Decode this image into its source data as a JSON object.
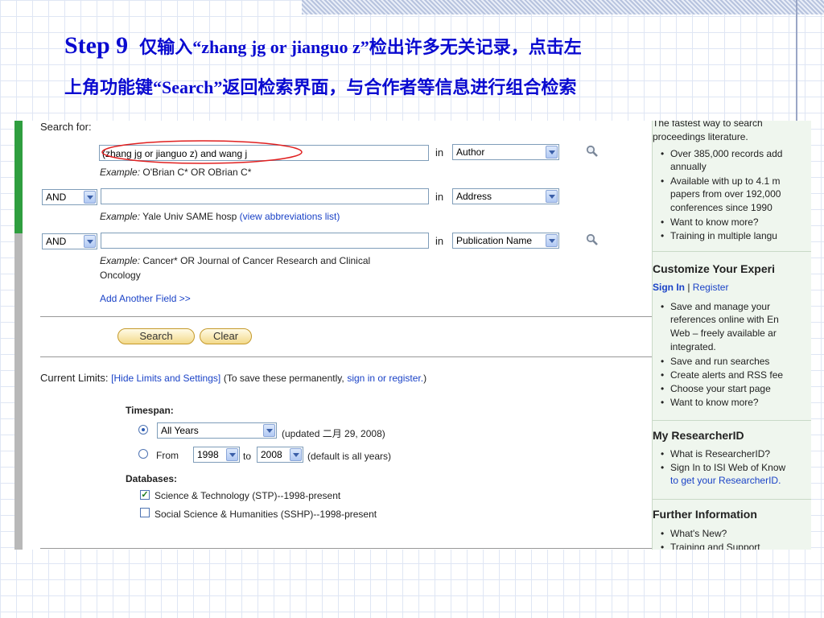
{
  "slide": {
    "step": "Step 9",
    "title_line1": "仅输入“zhang jg or jianguo z”检出许多无关记录，点击左",
    "title_line2": "上角功能键“Search”返回检索界面，与合作者等信息进行组合检索"
  },
  "search": {
    "heading": "Search for:",
    "in_label": "in",
    "rows": [
      {
        "operator": "",
        "value": "(zhang jg or jianguo z) and wang j",
        "field": "Author",
        "example_prefix": "Example:",
        "example": "O'Brian C* OR OBrian C*"
      },
      {
        "operator": "AND",
        "value": "",
        "field": "Address",
        "example_prefix": "Example:",
        "example": "Yale Univ SAME hosp",
        "example_link": "(view abbreviations list)"
      },
      {
        "operator": "AND",
        "value": "",
        "field": "Publication Name",
        "example_prefix": "Example:",
        "example": "Cancer* OR Journal of Cancer Research and Clinical",
        "example_line2": "Oncology"
      }
    ],
    "add_field": "Add Another Field >>",
    "search_button": "Search",
    "clear_button": "Clear"
  },
  "limits": {
    "label": "Current Limits:",
    "hide_link": "[Hide Limits and Settings]",
    "save_prefix": "(To save these permanently,",
    "save_link": "sign in or register.",
    "save_suffix": ")",
    "timespan_label": "Timespan:",
    "all_years": "All Years",
    "updated": "(updated 二月 29, 2008)",
    "from_label": "From",
    "from_year": "1998",
    "to_label": "to",
    "to_year": "2008",
    "default_note": "(default is all years)",
    "databases_label": "Databases:",
    "db1": "Science & Technology (STP)--1998-present",
    "db2": "Social Science & Humanities (SSHP)--1998-present"
  },
  "sidebar": {
    "intro1": "The fastest way to search",
    "intro2": "proceedings literature.",
    "bullets1": [
      "Over 385,000 records add",
      "annually",
      "Available with up to 4.1 m",
      "papers from over 192,000",
      "conferences since 1990",
      "Want to know more?",
      "Training in multiple langu"
    ],
    "customize_title": "Customize Your Experi",
    "sign_in": "Sign In",
    "pipe": " | ",
    "register": "Register",
    "bullets2": [
      "Save and manage your",
      "references online with En",
      "Web  – freely available ar",
      "integrated.",
      "Save and run searches",
      "Create alerts and RSS fee",
      "Choose your start page",
      "Want to know more?"
    ],
    "researcher_title": "My ResearcherID",
    "bullets3": [
      "What is ResearcherID?",
      "Sign In to ISI Web of Know",
      "to get your ResearcherID."
    ],
    "further_title": "Further Information",
    "bullets4": [
      "What's New?",
      "Training and Support"
    ]
  },
  "colors": {
    "title": "#0a0ad0",
    "link": "#1b43c7",
    "annotation": "#e02020",
    "green": "#2f9e3f"
  }
}
